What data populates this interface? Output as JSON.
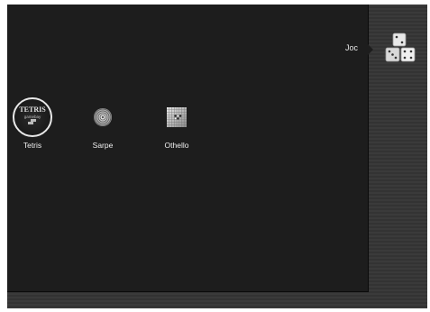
{
  "category": {
    "label": "Joc",
    "icon": "dice-icon"
  },
  "games": [
    {
      "label": "Tetris",
      "icon": "tetris-logo-icon",
      "logo_lines": [
        "TETRIS",
        "gamebay"
      ],
      "selected": true
    },
    {
      "label": "Sarpe",
      "icon": "spiral-snake-icon",
      "selected": false
    },
    {
      "label": "Othello",
      "icon": "othello-board-icon",
      "selected": false
    }
  ],
  "colors": {
    "panel": "#1d1d1d",
    "background": "#3a3a3a",
    "text": "#f0f0f0",
    "selection_ring": "#e8e8e8"
  }
}
